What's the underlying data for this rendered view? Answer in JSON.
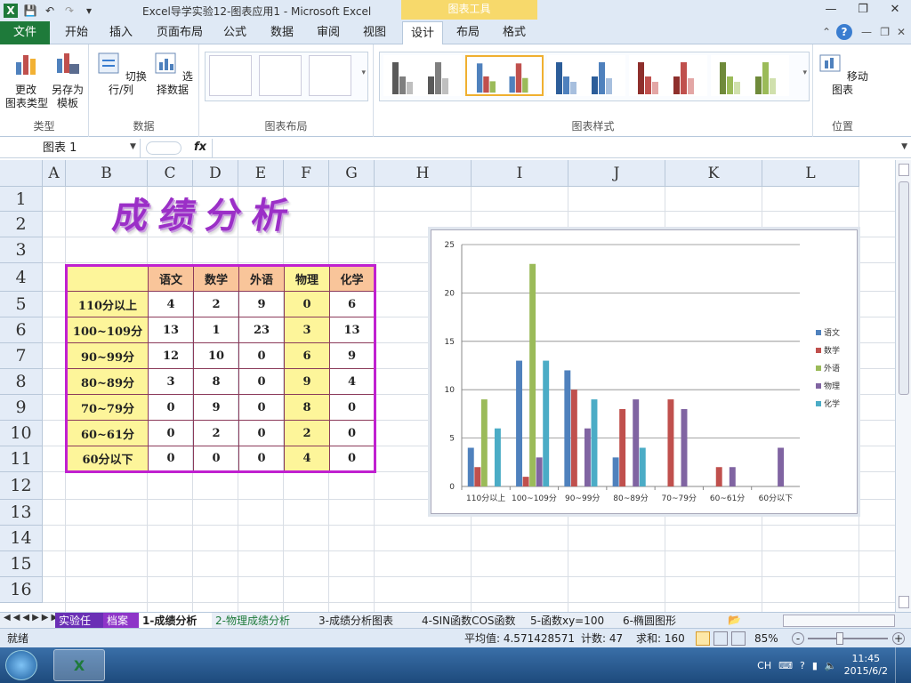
{
  "window": {
    "title": "Excel导学实验12-图表应用1  -  Microsoft Excel",
    "context_header": "图表工具"
  },
  "tabs": [
    "文件",
    "开始",
    "插入",
    "页面布局",
    "公式",
    "数据",
    "审阅",
    "视图",
    "设计",
    "布局",
    "格式"
  ],
  "ribbon": {
    "groups": {
      "type": "类型",
      "data": "数据",
      "layout": "图表布局",
      "style": "图表样式",
      "location": "位置"
    },
    "change_type": "更改\n图表类型",
    "save_template": "另存为\n模板",
    "switch_rowcol": "切换行/列",
    "select_data": "选择数据",
    "move_chart": "移动图表"
  },
  "formula_bar": {
    "name_box": "图表  1",
    "fx": "fx"
  },
  "columns": [
    "A",
    "B",
    "C",
    "D",
    "E",
    "F",
    "G",
    "H",
    "I",
    "J",
    "K",
    "L"
  ],
  "rows": [
    "1",
    "2",
    "3",
    "4",
    "5",
    "6",
    "7",
    "8",
    "9",
    "10",
    "11",
    "12",
    "13",
    "14",
    "15",
    "16"
  ],
  "sheet_title": "成绩分析",
  "table": {
    "headers": [
      "",
      "语文",
      "数学",
      "外语",
      "物理",
      "化学"
    ],
    "rows": [
      [
        "110分以上",
        "4",
        "2",
        "9",
        "0",
        "6"
      ],
      [
        "100~109分",
        "13",
        "1",
        "23",
        "3",
        "13"
      ],
      [
        "90~99分",
        "12",
        "10",
        "0",
        "6",
        "9"
      ],
      [
        "80~89分",
        "3",
        "8",
        "0",
        "9",
        "4"
      ],
      [
        "70~79分",
        "0",
        "9",
        "0",
        "8",
        "0"
      ],
      [
        "60~61分",
        "0",
        "2",
        "0",
        "2",
        "0"
      ],
      [
        "60分以下",
        "0",
        "0",
        "0",
        "4",
        "0"
      ]
    ]
  },
  "chart_data": {
    "type": "bar",
    "categories": [
      "110分以上",
      "100~109分",
      "90~99分",
      "80~89分",
      "70~79分",
      "60~61分",
      "60分以下"
    ],
    "series": [
      {
        "name": "语文",
        "color": "#4f81bd",
        "values": [
          4,
          13,
          12,
          3,
          0,
          0,
          0
        ]
      },
      {
        "name": "数学",
        "color": "#c0504d",
        "values": [
          2,
          1,
          10,
          8,
          9,
          2,
          0
        ]
      },
      {
        "name": "外语",
        "color": "#9bbb59",
        "values": [
          9,
          23,
          0,
          0,
          0,
          0,
          0
        ]
      },
      {
        "name": "物理",
        "color": "#8064a2",
        "values": [
          0,
          3,
          6,
          9,
          8,
          2,
          4
        ]
      },
      {
        "name": "化学",
        "color": "#4bacc6",
        "values": [
          6,
          13,
          9,
          4,
          0,
          0,
          0
        ]
      }
    ],
    "ylim": [
      0,
      25
    ],
    "yticks": [
      "0",
      "5",
      "10",
      "15",
      "20",
      "25"
    ],
    "grid": true,
    "legend": "right"
  },
  "sheet_tabs": [
    "实验任务",
    "档案",
    "1-成绩分析",
    "2-物理成绩分析",
    "3-成绩分析图表",
    "4-SIN函数COS函数",
    "5-函数xy=100",
    "6-椭圆图形"
  ],
  "status": {
    "ready": "就绪",
    "average": "平均值: 4.571428571",
    "count": "计数: 47",
    "sum": "求和: 160",
    "zoom": "85%"
  },
  "taskbar": {
    "lang": "CH",
    "time": "11:45",
    "date": "2015/6/2"
  }
}
